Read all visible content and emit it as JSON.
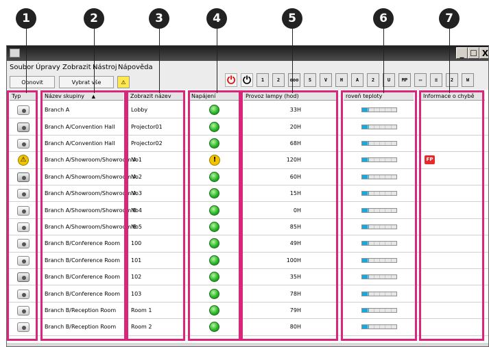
{
  "callouts": [
    "1",
    "2",
    "3",
    "4",
    "5",
    "6",
    "7"
  ],
  "window": {
    "title": "",
    "buttons": [
      "_",
      "☐",
      "X"
    ]
  },
  "menu": [
    "Soubor",
    "Úpravy",
    "Zobrazit",
    "Nástroj",
    "Nápověda"
  ],
  "toolbar": {
    "refresh": "Obnovit",
    "select": "Vybrat vše",
    "warn_icon": "warning-icon"
  },
  "toolbar_icons": [
    "power-on-icon",
    "power-off-icon",
    "source-1-icon",
    "source-2-icon",
    "more-icon",
    "s-icon",
    "video-icon",
    "hdmi-icon",
    "a-v-mute-icon",
    "network-2-icon",
    "usb-icon",
    "mp-icon",
    "monitor-icon",
    "lan-icon",
    "usb-display-icon",
    "wireless-icon"
  ],
  "columns": {
    "type": "Typ",
    "group": "Název skupiny",
    "name": "Zobrazit název",
    "power": "Napájení",
    "lamp": "Provoz lampy (hod)",
    "temp": "roveň teploty",
    "error": "Informace o chybě"
  },
  "sort_indicator": "▲",
  "rows": [
    {
      "type": "projector",
      "group": "Branch A",
      "name": "Lobby",
      "power": "on",
      "lamp": "33H",
      "temp": 0.2,
      "error": ""
    },
    {
      "type": "group",
      "group": "Branch A/Convention Hall",
      "name": "Projector01",
      "power": "on",
      "lamp": "20H",
      "temp": 0.2,
      "error": ""
    },
    {
      "type": "projector",
      "group": "Branch A/Convention Hall",
      "name": "Projector02",
      "power": "on",
      "lamp": "68H",
      "temp": 0.2,
      "error": ""
    },
    {
      "type": "warning",
      "group": "Branch A/Showroom/Showroom A",
      "name": "No1",
      "power": "warning",
      "lamp": "120H",
      "temp": 0.2,
      "error": "FP"
    },
    {
      "type": "group",
      "group": "Branch A/Showroom/Showroom A",
      "name": "No2",
      "power": "on",
      "lamp": "60H",
      "temp": 0.2,
      "error": ""
    },
    {
      "type": "projector",
      "group": "Branch A/Showroom/Showroom A",
      "name": "No3",
      "power": "on",
      "lamp": "15H",
      "temp": 0.2,
      "error": ""
    },
    {
      "type": "projector",
      "group": "Branch A/Showroom/Showroom B",
      "name": "No4",
      "power": "on",
      "lamp": "0H",
      "temp": 0.2,
      "error": ""
    },
    {
      "type": "projector",
      "group": "Branch A/Showroom/Showroom B",
      "name": "No5",
      "power": "on",
      "lamp": "85H",
      "temp": 0.2,
      "error": ""
    },
    {
      "type": "projector",
      "group": "Branch B/Conference Room",
      "name": "100",
      "power": "on",
      "lamp": "49H",
      "temp": 0.2,
      "error": ""
    },
    {
      "type": "projector",
      "group": "Branch B/Conference Room",
      "name": "101",
      "power": "on",
      "lamp": "100H",
      "temp": 0.2,
      "error": ""
    },
    {
      "type": "group",
      "group": "Branch B/Conference Room",
      "name": "102",
      "power": "on",
      "lamp": "35H",
      "temp": 0.2,
      "error": ""
    },
    {
      "type": "projector",
      "group": "Branch B/Conference Room",
      "name": "103",
      "power": "on",
      "lamp": "78H",
      "temp": 0.2,
      "error": ""
    },
    {
      "type": "projector",
      "group": "Branch B/Reception Room",
      "name": "Room 1",
      "power": "on",
      "lamp": "79H",
      "temp": 0.2,
      "error": ""
    },
    {
      "type": "projector",
      "group": "Branch B/Reception Room",
      "name": "Room 2",
      "power": "on",
      "lamp": "80H",
      "temp": 0.2,
      "error": ""
    }
  ],
  "colors": {
    "highlight": "#d8277b",
    "power_on": "#2bb82b",
    "temp_fill": "#1aa9d9",
    "error": "#e52b2b"
  }
}
